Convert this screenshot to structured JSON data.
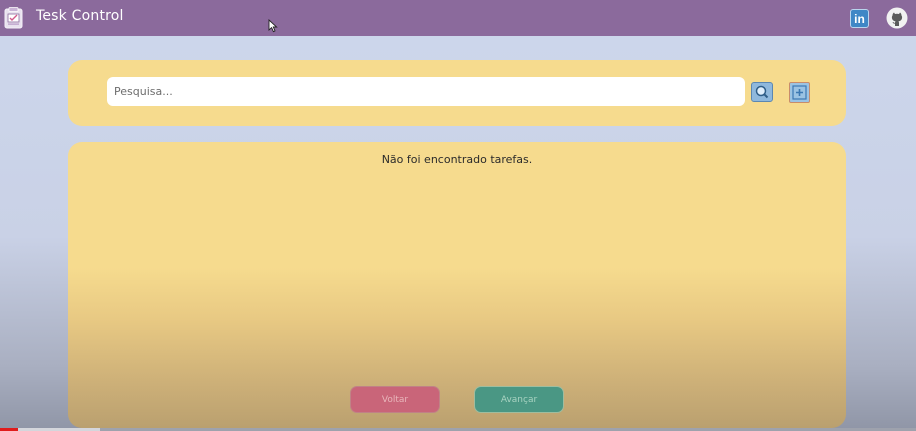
{
  "header": {
    "title": "Tesk Control",
    "logo_icon": "clipboard-icon",
    "links": [
      {
        "label": "in",
        "icon": "linkedin-icon"
      },
      {
        "icon": "github-icon"
      }
    ],
    "background_color": "#8b6a9c"
  },
  "search": {
    "placeholder": "Pesquisa...",
    "value": "",
    "search_button_icon": "magnifier-icon",
    "add_button_icon": "add-icon"
  },
  "tasks": {
    "empty_message": "Não foi encontrado tarefas.",
    "items": []
  },
  "pagination": {
    "back_label": "Voltar",
    "next_label": "Avançar"
  },
  "video_progress": {
    "played_fraction": 0.02,
    "buffered_fraction": 0.11
  },
  "colors": {
    "card": "#f6db8e",
    "back_button": "#c96579",
    "next_button": "#4a9784"
  }
}
